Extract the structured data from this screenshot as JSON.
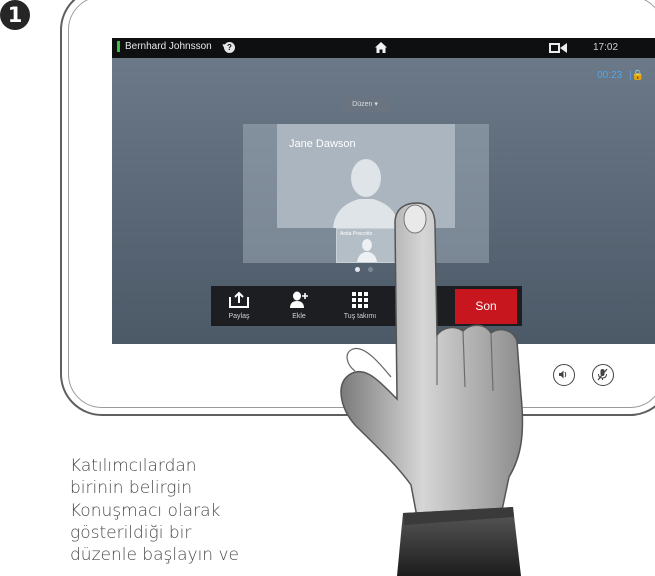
{
  "step_number": "1",
  "status_bar": {
    "user_name": "Bernhard Johnsson",
    "help_glyph": "?",
    "time": "17:02"
  },
  "call": {
    "duration": "00:23"
  },
  "layout_button": {
    "label": "Düzen"
  },
  "speaker": {
    "name": "Jane Dawson"
  },
  "participant_thumb": {
    "name": "Anita Poscotto"
  },
  "toolbar": {
    "share_label": "Paylaş",
    "add_label": "Ekle",
    "keypad_label": "Tuş takımı",
    "end_label": "Son"
  },
  "instruction_lines": [
    "Katılımcılardan",
    "birinin belirgin",
    "Konuşmacı olarak",
    "gösterildiği bir",
    "düzenle başlayın ve"
  ],
  "colors": {
    "end_call": "#c8161f",
    "timer": "#4fa8ec",
    "status_indicator": "#3fbf3f"
  }
}
